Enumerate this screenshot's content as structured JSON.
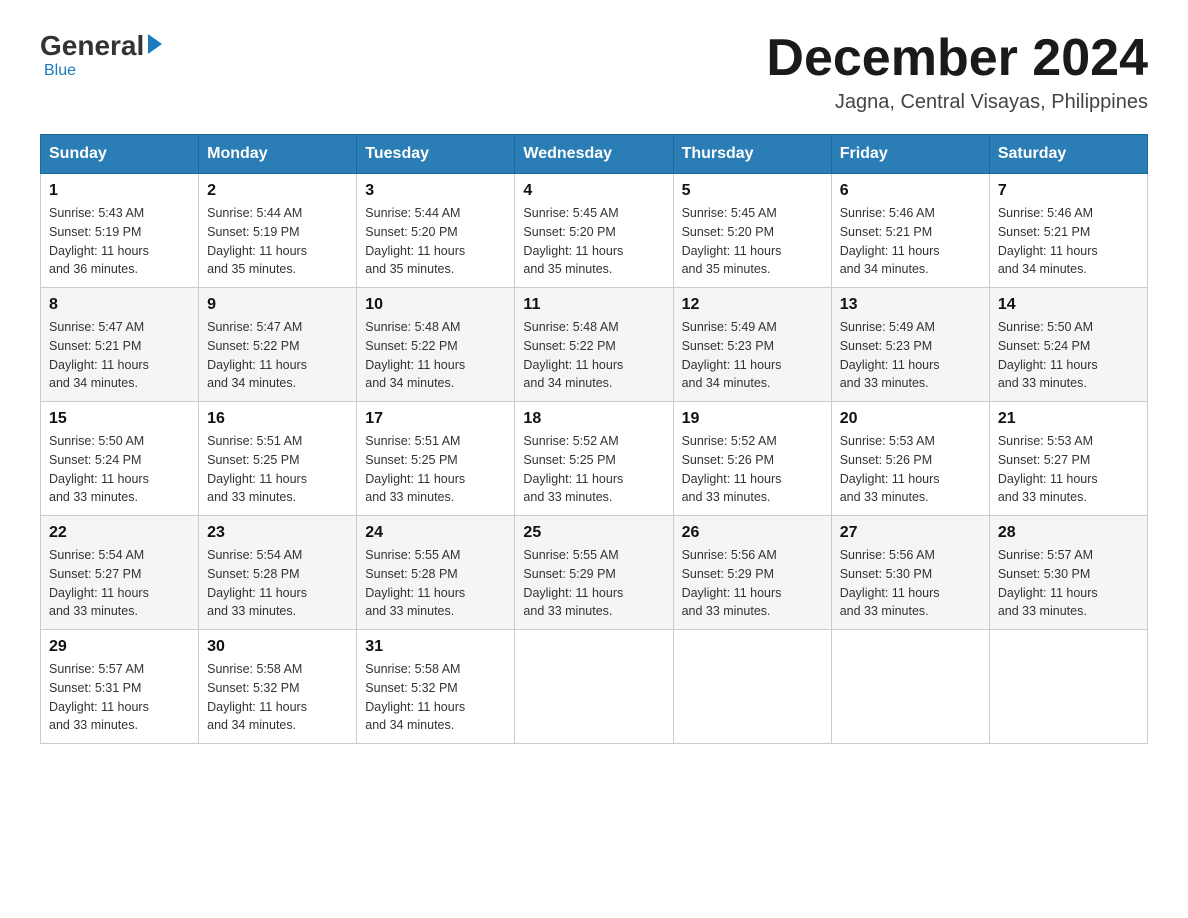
{
  "header": {
    "logo_general": "General",
    "logo_blue": "Blue",
    "month_title": "December 2024",
    "location": "Jagna, Central Visayas, Philippines"
  },
  "days_of_week": [
    "Sunday",
    "Monday",
    "Tuesday",
    "Wednesday",
    "Thursday",
    "Friday",
    "Saturday"
  ],
  "weeks": [
    [
      {
        "day": "1",
        "sunrise": "5:43 AM",
        "sunset": "5:19 PM",
        "daylight": "11 hours and 36 minutes."
      },
      {
        "day": "2",
        "sunrise": "5:44 AM",
        "sunset": "5:19 PM",
        "daylight": "11 hours and 35 minutes."
      },
      {
        "day": "3",
        "sunrise": "5:44 AM",
        "sunset": "5:20 PM",
        "daylight": "11 hours and 35 minutes."
      },
      {
        "day": "4",
        "sunrise": "5:45 AM",
        "sunset": "5:20 PM",
        "daylight": "11 hours and 35 minutes."
      },
      {
        "day": "5",
        "sunrise": "5:45 AM",
        "sunset": "5:20 PM",
        "daylight": "11 hours and 35 minutes."
      },
      {
        "day": "6",
        "sunrise": "5:46 AM",
        "sunset": "5:21 PM",
        "daylight": "11 hours and 34 minutes."
      },
      {
        "day": "7",
        "sunrise": "5:46 AM",
        "sunset": "5:21 PM",
        "daylight": "11 hours and 34 minutes."
      }
    ],
    [
      {
        "day": "8",
        "sunrise": "5:47 AM",
        "sunset": "5:21 PM",
        "daylight": "11 hours and 34 minutes."
      },
      {
        "day": "9",
        "sunrise": "5:47 AM",
        "sunset": "5:22 PM",
        "daylight": "11 hours and 34 minutes."
      },
      {
        "day": "10",
        "sunrise": "5:48 AM",
        "sunset": "5:22 PM",
        "daylight": "11 hours and 34 minutes."
      },
      {
        "day": "11",
        "sunrise": "5:48 AM",
        "sunset": "5:22 PM",
        "daylight": "11 hours and 34 minutes."
      },
      {
        "day": "12",
        "sunrise": "5:49 AM",
        "sunset": "5:23 PM",
        "daylight": "11 hours and 34 minutes."
      },
      {
        "day": "13",
        "sunrise": "5:49 AM",
        "sunset": "5:23 PM",
        "daylight": "11 hours and 33 minutes."
      },
      {
        "day": "14",
        "sunrise": "5:50 AM",
        "sunset": "5:24 PM",
        "daylight": "11 hours and 33 minutes."
      }
    ],
    [
      {
        "day": "15",
        "sunrise": "5:50 AM",
        "sunset": "5:24 PM",
        "daylight": "11 hours and 33 minutes."
      },
      {
        "day": "16",
        "sunrise": "5:51 AM",
        "sunset": "5:25 PM",
        "daylight": "11 hours and 33 minutes."
      },
      {
        "day": "17",
        "sunrise": "5:51 AM",
        "sunset": "5:25 PM",
        "daylight": "11 hours and 33 minutes."
      },
      {
        "day": "18",
        "sunrise": "5:52 AM",
        "sunset": "5:25 PM",
        "daylight": "11 hours and 33 minutes."
      },
      {
        "day": "19",
        "sunrise": "5:52 AM",
        "sunset": "5:26 PM",
        "daylight": "11 hours and 33 minutes."
      },
      {
        "day": "20",
        "sunrise": "5:53 AM",
        "sunset": "5:26 PM",
        "daylight": "11 hours and 33 minutes."
      },
      {
        "day": "21",
        "sunrise": "5:53 AM",
        "sunset": "5:27 PM",
        "daylight": "11 hours and 33 minutes."
      }
    ],
    [
      {
        "day": "22",
        "sunrise": "5:54 AM",
        "sunset": "5:27 PM",
        "daylight": "11 hours and 33 minutes."
      },
      {
        "day": "23",
        "sunrise": "5:54 AM",
        "sunset": "5:28 PM",
        "daylight": "11 hours and 33 minutes."
      },
      {
        "day": "24",
        "sunrise": "5:55 AM",
        "sunset": "5:28 PM",
        "daylight": "11 hours and 33 minutes."
      },
      {
        "day": "25",
        "sunrise": "5:55 AM",
        "sunset": "5:29 PM",
        "daylight": "11 hours and 33 minutes."
      },
      {
        "day": "26",
        "sunrise": "5:56 AM",
        "sunset": "5:29 PM",
        "daylight": "11 hours and 33 minutes."
      },
      {
        "day": "27",
        "sunrise": "5:56 AM",
        "sunset": "5:30 PM",
        "daylight": "11 hours and 33 minutes."
      },
      {
        "day": "28",
        "sunrise": "5:57 AM",
        "sunset": "5:30 PM",
        "daylight": "11 hours and 33 minutes."
      }
    ],
    [
      {
        "day": "29",
        "sunrise": "5:57 AM",
        "sunset": "5:31 PM",
        "daylight": "11 hours and 33 minutes."
      },
      {
        "day": "30",
        "sunrise": "5:58 AM",
        "sunset": "5:32 PM",
        "daylight": "11 hours and 34 minutes."
      },
      {
        "day": "31",
        "sunrise": "5:58 AM",
        "sunset": "5:32 PM",
        "daylight": "11 hours and 34 minutes."
      },
      null,
      null,
      null,
      null
    ]
  ],
  "labels": {
    "sunrise": "Sunrise:",
    "sunset": "Sunset:",
    "daylight": "Daylight:"
  }
}
